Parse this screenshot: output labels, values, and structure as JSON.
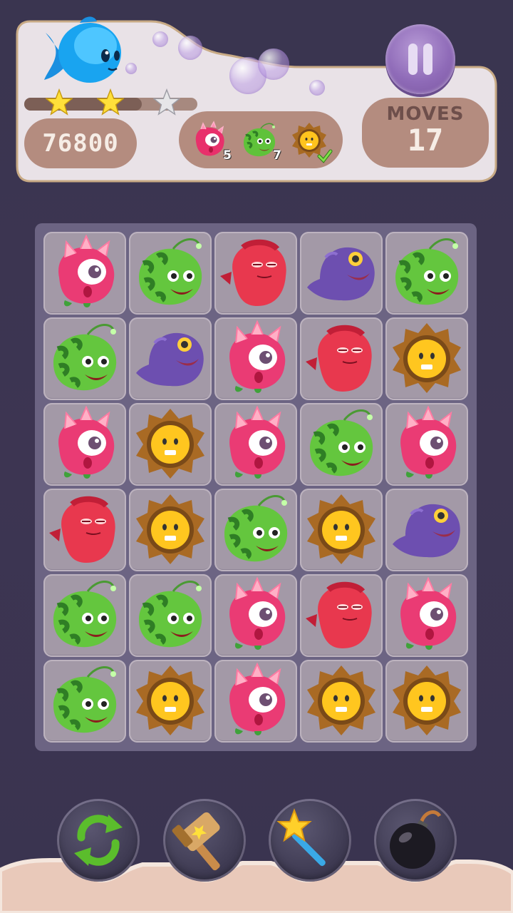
{
  "level": {
    "score": "76800",
    "stars": {
      "earned": 2,
      "total": 3
    },
    "star_progress": 0.68,
    "moves_label": "MOVES",
    "moves_value": "17"
  },
  "goals": [
    {
      "creature": "pink-one-eyed-monster",
      "count": "5",
      "done": false
    },
    {
      "creature": "green-anglerfish",
      "count": "7",
      "done": false
    },
    {
      "creature": "spiky-yellow-monster",
      "count": "",
      "done": true
    }
  ],
  "board": {
    "rows": 6,
    "cols": 5,
    "tiles": [
      [
        "pink",
        "green",
        "red",
        "purple",
        "green"
      ],
      [
        "green",
        "purple",
        "pink",
        "red",
        "yellow"
      ],
      [
        "pink",
        "yellow",
        "pink",
        "green",
        "pink"
      ],
      [
        "red",
        "yellow",
        "green",
        "yellow",
        "purple"
      ],
      [
        "green",
        "green",
        "pink",
        "red",
        "pink"
      ],
      [
        "green",
        "yellow",
        "pink",
        "yellow",
        "yellow"
      ]
    ]
  },
  "boosters": [
    {
      "name": "shuffle",
      "icon": "refresh-icon"
    },
    {
      "name": "hammer",
      "icon": "hammer-icon"
    },
    {
      "name": "magic-wand",
      "icon": "wand-icon"
    },
    {
      "name": "bomb",
      "icon": "bomb-icon"
    }
  ],
  "colors": {
    "panel": "#e9e2e7",
    "chip": "#b48c7f",
    "board": "#6c6483",
    "tile": "#a399a7"
  }
}
